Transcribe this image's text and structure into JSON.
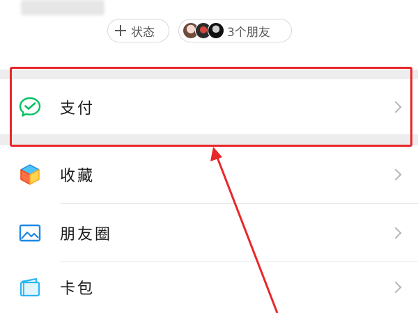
{
  "profile": {
    "status_chip": "状态",
    "friends_chip": "3个朋友"
  },
  "menu": {
    "items": [
      {
        "label": "支付",
        "icon": "wechat-pay-icon"
      },
      {
        "label": "收藏",
        "icon": "favorites-cube-icon"
      },
      {
        "label": "朋友圈",
        "icon": "moments-image-icon"
      },
      {
        "label": "卡包",
        "icon": "card-wallet-icon"
      }
    ]
  },
  "colors": {
    "pay_green": "#07c160",
    "moments_blue": "#1e88e5",
    "annotation_red": "#e8272a"
  }
}
